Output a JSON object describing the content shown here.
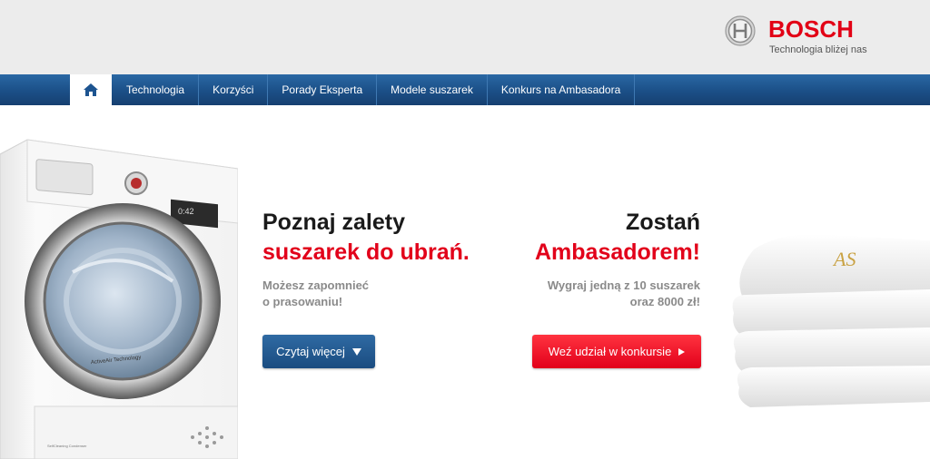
{
  "brand": {
    "name": "BOSCH",
    "tagline": "Technologia bliżej nas",
    "color": "#e2001a"
  },
  "nav": {
    "home_icon": "home-icon",
    "items": [
      {
        "label": "Technologia"
      },
      {
        "label": "Korzyści"
      },
      {
        "label": "Porady Eksperta"
      },
      {
        "label": "Modele suszarek"
      },
      {
        "label": "Konkurs na Ambasadora"
      }
    ]
  },
  "hero": {
    "left": {
      "heading_line1": "Poznaj zalety",
      "heading_line2": "suszarek do ubrań.",
      "subtext_line1": "Możesz zapomnieć",
      "subtext_line2": "o prasowaniu!",
      "button_label": "Czytaj więcej",
      "button_icon": "triangle-down-icon"
    },
    "right": {
      "heading_line1": "Zostań",
      "heading_line2": "Ambasadorem!",
      "subtext_line1": "Wygraj jedną z 10 suszarek",
      "subtext_line2": "oraz 8000 zł!",
      "button_label": "Weź udział w konkursie",
      "button_icon": "triangle-right-icon"
    },
    "washer_label": "ActiveAir Technology",
    "washer_small_label": "SelfCleaning Condenser",
    "washer_display": "0:42",
    "towel_monogram": "AS"
  },
  "colors": {
    "nav_blue": "#1b4f87",
    "accent_red": "#e2001a",
    "heading_dark": "#1a1a1a",
    "subtext_grey": "#8a8a8a"
  }
}
